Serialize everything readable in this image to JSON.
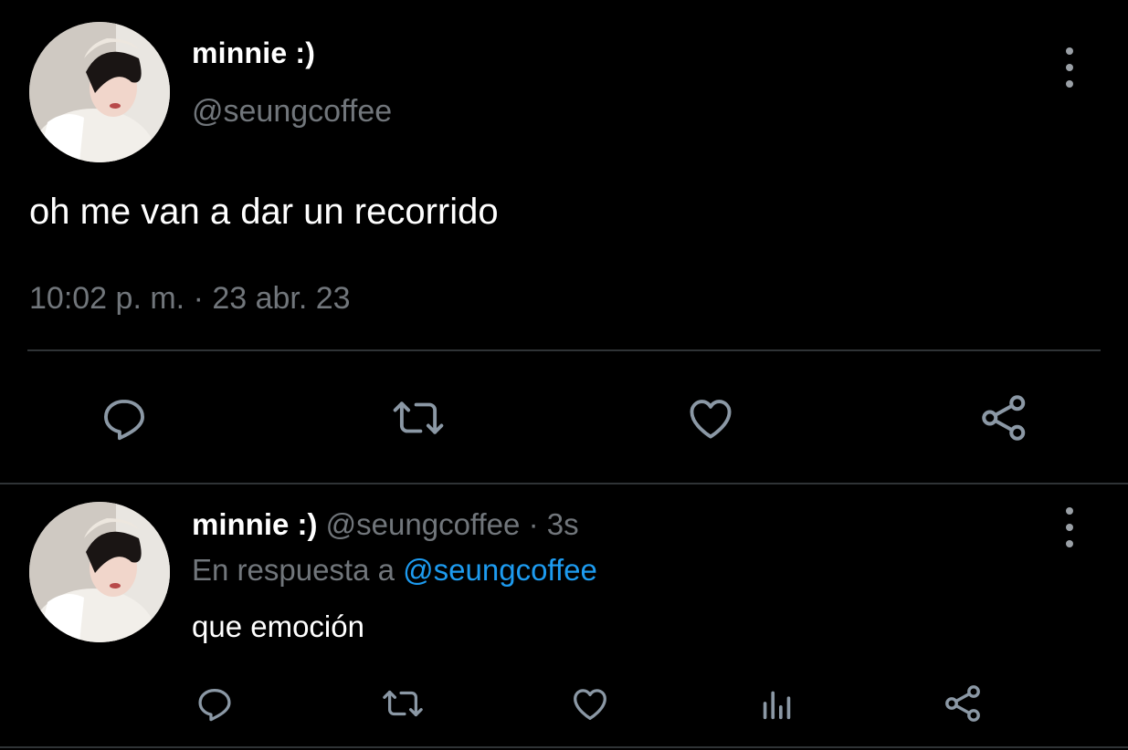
{
  "main_tweet": {
    "author_name": "minnie :)",
    "handle": "@seungcoffee",
    "text": "oh me van a dar un recorrido",
    "time": "10:02 p. m.",
    "separator": "·",
    "date": "23 abr. 23",
    "actions": [
      "reply-icon",
      "retweet-icon",
      "like-icon",
      "share-icon"
    ]
  },
  "reply_tweet": {
    "author_name": "minnie :)",
    "handle": "@seungcoffee",
    "separator": "·",
    "age": "3s",
    "replying_prefix": "En respuesta a",
    "replying_to": "@seungcoffee",
    "text": "que emoción",
    "actions": [
      "reply-icon",
      "retweet-icon",
      "like-icon",
      "analytics-icon",
      "share-icon"
    ]
  },
  "colors": {
    "background": "#000000",
    "primary_text": "#ffffff",
    "secondary_text": "#71767b",
    "link": "#1d9bf0",
    "divider": "#2f3336",
    "icon": "#8b98a5"
  }
}
